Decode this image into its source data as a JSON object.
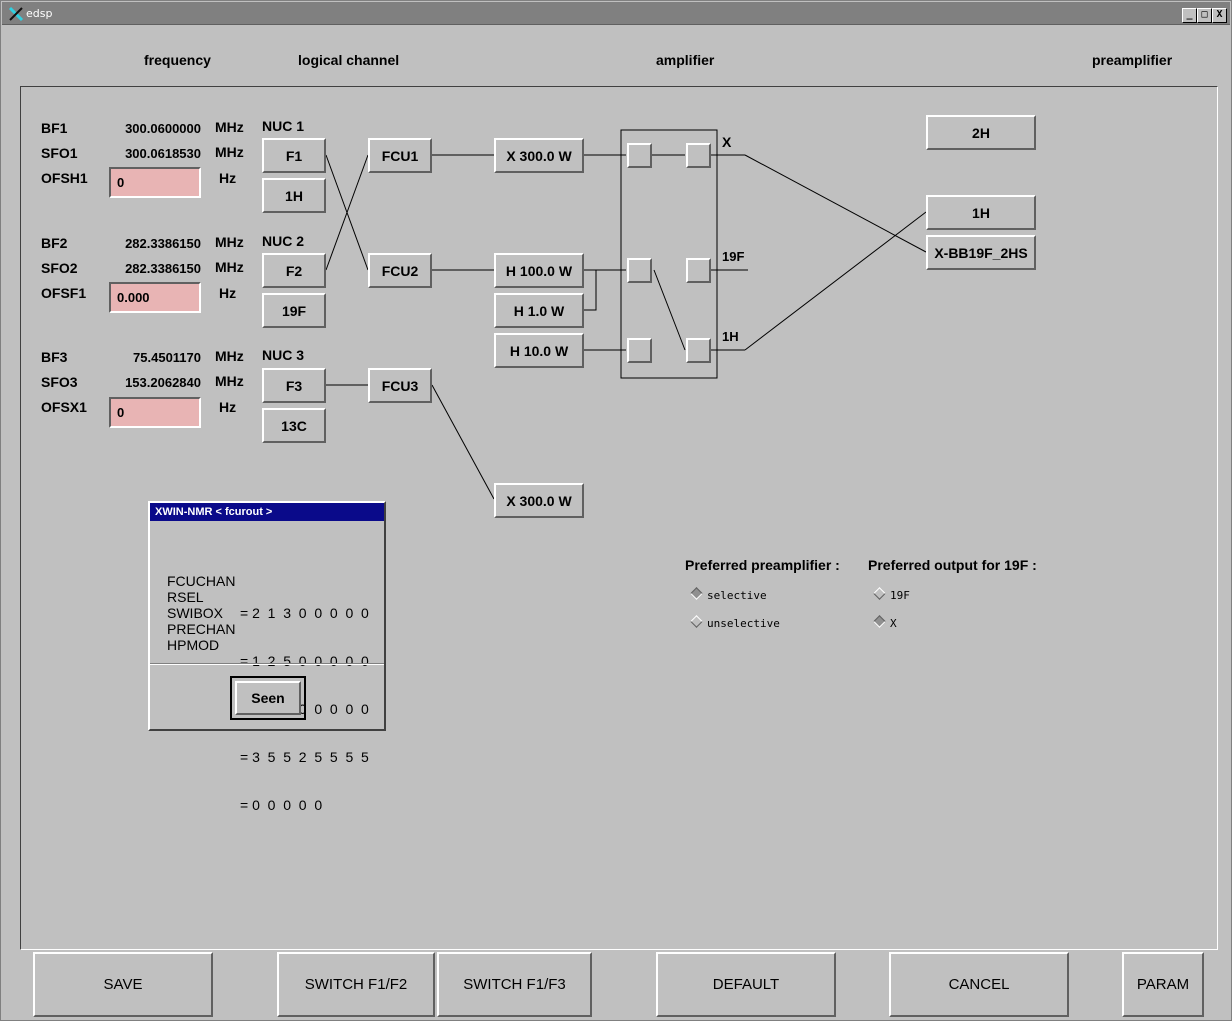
{
  "window": {
    "title": "edsp",
    "controls": [
      "_",
      "□",
      "X"
    ]
  },
  "headers": {
    "frequency": "frequency",
    "logical_channel": "logical channel",
    "amplifier": "amplifier",
    "preamplifier": "preamplifier"
  },
  "channels": [
    {
      "bf_label": "BF1",
      "bf_value": "300.0600000",
      "bf_unit": "MHz",
      "sfo_label": "SFO1",
      "sfo_value": "300.0618530",
      "sfo_unit": "MHz",
      "ofs_label": "OFSH1",
      "ofs_value": "0",
      "ofs_unit": "Hz",
      "nuc_label": "NUC 1",
      "f_button": "F1",
      "nuc_button": "1H",
      "fcu": "FCU1"
    },
    {
      "bf_label": "BF2",
      "bf_value": "282.3386150",
      "bf_unit": "MHz",
      "sfo_label": "SFO2",
      "sfo_value": "282.3386150",
      "sfo_unit": "MHz",
      "ofs_label": "OFSF1",
      "ofs_value": "0.000",
      "ofs_unit": "Hz",
      "nuc_label": "NUC 2",
      "f_button": "F2",
      "nuc_button": "19F",
      "fcu": "FCU2"
    },
    {
      "bf_label": "BF3",
      "bf_value": "75.4501170",
      "bf_unit": "MHz",
      "sfo_label": "SFO3",
      "sfo_value": "153.2062840",
      "sfo_unit": "MHz",
      "ofs_label": "OFSX1",
      "ofs_value": "0",
      "ofs_unit": "Hz",
      "nuc_label": "NUC 3",
      "f_button": "F3",
      "nuc_button": "13C",
      "fcu": "FCU3"
    }
  ],
  "amplifiers": [
    "X 300.0 W",
    "H 100.0 W",
    "H 1.0 W",
    "H 10.0 W",
    "X 300.0 W"
  ],
  "router_outputs": {
    "x": "X",
    "f19": "19F",
    "h1": "1H"
  },
  "preamplifiers": [
    "2H",
    "1H",
    "X-BB19F_2HS"
  ],
  "preferred_preamp": {
    "label": "Preferred preamplifier :",
    "options": [
      {
        "label": "selective",
        "selected": true
      },
      {
        "label": "unselective",
        "selected": false
      }
    ]
  },
  "preferred_output": {
    "label": "Preferred output for 19F :",
    "options": [
      {
        "label": "19F",
        "selected": false
      },
      {
        "label": "X",
        "selected": true
      }
    ]
  },
  "dialog": {
    "title": "XWIN-NMR  < fcurout >",
    "lines": [
      {
        "key": "FCUCHAN",
        "value": "= 2  1  3  0  0  0  0  0"
      },
      {
        "key": "RSEL",
        "value": "= 1  2  5  0  0  0  0  0"
      },
      {
        "key": "SWIBOX",
        "value": "= 1  4  4  0  0  0  0  0"
      },
      {
        "key": "PRECHAN",
        "value": "= 3  5  5  2  5  5  5  5"
      },
      {
        "key": "HPMOD",
        "value": "= 0  0  0  0  0"
      }
    ],
    "button": "Seen"
  },
  "bottom_buttons": {
    "save": "SAVE",
    "switch12": "SWITCH   F1/F2",
    "switch13": "SWITCH   F1/F3",
    "default": "DEFAULT",
    "cancel": "CANCEL",
    "param": "PARAM"
  }
}
